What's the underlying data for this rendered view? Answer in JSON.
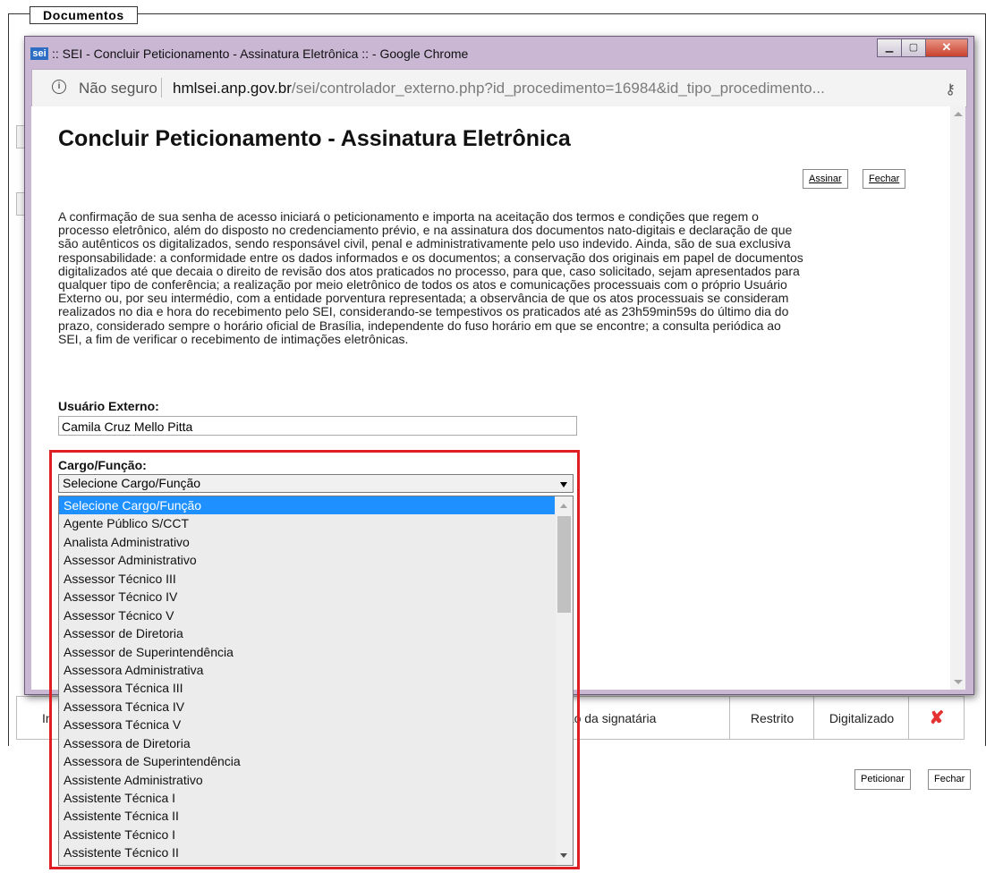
{
  "background": {
    "legend": "Documentos",
    "table_row": {
      "col1": "In",
      "col2": "ação da signatária",
      "col3": "Restrito",
      "col4": "Digitalizado"
    },
    "buttons": {
      "peticionar": "Peticionar",
      "fechar": "Fechar"
    }
  },
  "window": {
    "title": ":: SEI - Concluir Peticionamento - Assinatura Eletrônica :: - Google Chrome",
    "logo": "sei",
    "address": {
      "security": "Não seguro",
      "domain": "hmlsei.anp.gov.br",
      "path": "/sei/controlador_externo.php?id_procedimento=16984&id_tipo_procedimento..."
    }
  },
  "page": {
    "title": "Concluir Peticionamento - Assinatura Eletrônica",
    "buttons": {
      "assinar": "Assinar",
      "fechar": "Fechar"
    },
    "terms_lines": [
      "A confirmação de sua senha de acesso iniciará o peticionamento e importa na aceitação dos termos e condições que regem o",
      "processo eletrônico, além do disposto no credenciamento prévio, e na assinatura dos documentos nato-digitais e declaração de que",
      "são autênticos os digitalizados, sendo responsável civil, penal e administrativamente pelo uso indevido. Ainda, são de sua exclusiva",
      "responsabilidade: a conformidade entre os dados informados e os documentos; a conservação dos originais em papel de documentos",
      "digitalizados até que decaia o direito de revisão dos atos praticados no processo, para que, caso solicitado, sejam apresentados para",
      "qualquer tipo de conferência; a realização por meio eletrônico de todos os atos e comunicações processuais com o próprio Usuário",
      "Externo ou, por seu intermédio, com a entidade porventura representada; a observância de que os atos processuais se consideram",
      "realizados no dia e hora do recebimento pelo SEI, considerando-se tempestivos os praticados até as 23h59min59s do último dia do",
      "prazo, considerado sempre o horário oficial de Brasília, independente do fuso horário em que se encontre; a consulta periódica ao",
      "SEI, a fim de verificar o recebimento de intimações eletrônicas."
    ],
    "usuario_label": "Usuário Externo:",
    "usuario_value": "Camila Cruz Mello Pitta",
    "cargo_label": "Cargo/Função:"
  },
  "dropdown": {
    "selected": "Selecione Cargo/Função",
    "options": [
      "Selecione Cargo/Função",
      "Agente Público S/CCT",
      "Analista Administrativo",
      "Assessor Administrativo",
      "Assessor Técnico III",
      "Assessor Técnico IV",
      "Assessor Técnico V",
      "Assessor de Diretoria",
      "Assessor de Superintendência",
      "Assessora Administrativa",
      "Assessora Técnica III",
      "Assessora Técnica IV",
      "Assessora Técnica V",
      "Assessora de Diretoria",
      "Assessora de Superintendência",
      "Assistente Administrativo",
      "Assistente Técnica I",
      "Assistente Técnica II",
      "Assistente Técnico I",
      "Assistente Técnico II"
    ],
    "highlighted_index": 0
  },
  "colors": {
    "highlight": "#e01f25",
    "selection": "#1e90ff",
    "window_frame": "#c9b7d4"
  }
}
